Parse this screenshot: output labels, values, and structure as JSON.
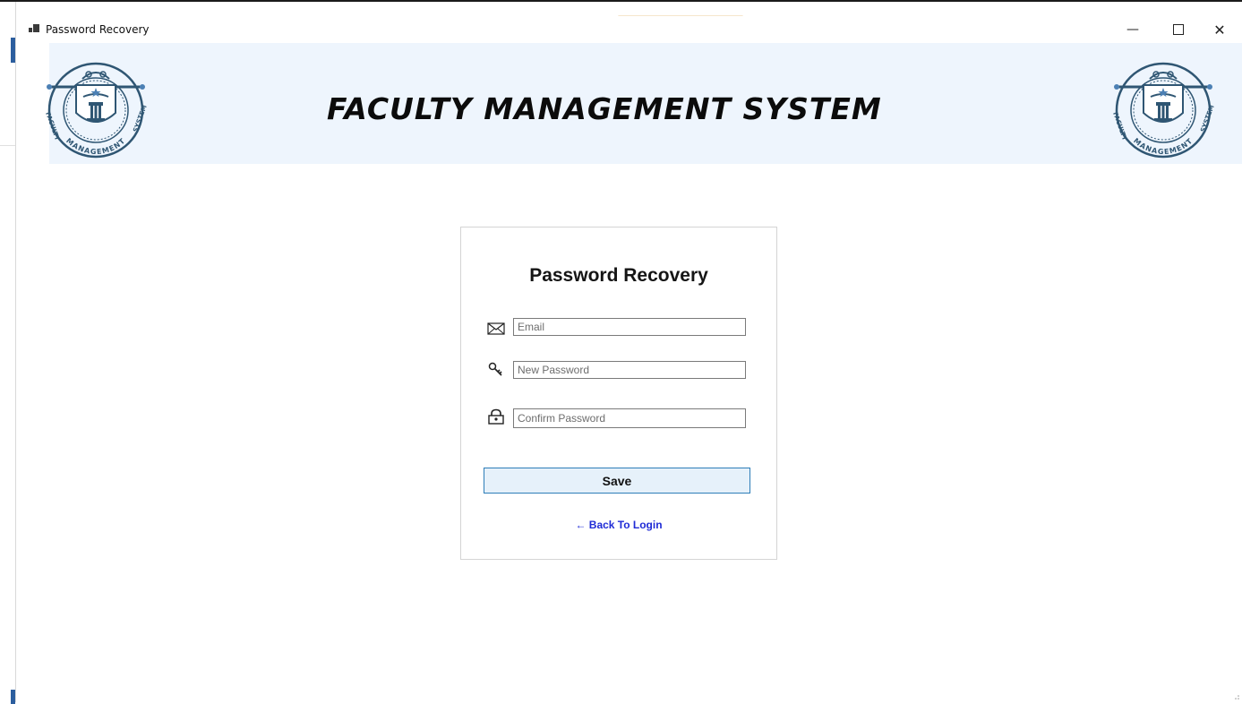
{
  "window": {
    "title": "Password Recovery",
    "controls": {
      "minimize": "—",
      "close": "✕"
    }
  },
  "header": {
    "app_title": "FACULTY MANAGEMENT SYSTEM",
    "logo_text_left": "FACULTY",
    "logo_text_bottom": "MANAGEMENT",
    "logo_text_right": "SYSTEM"
  },
  "form": {
    "title": "Password Recovery",
    "email": {
      "placeholder": "Email",
      "value": "",
      "icon": "envelope-icon"
    },
    "new_password": {
      "placeholder": "New Password",
      "value": "",
      "icon": "key-icon"
    },
    "confirm_password": {
      "placeholder": "Confirm Password",
      "value": "",
      "icon": "lock-icon"
    },
    "save_label": "Save",
    "back_link": "← Back To Login"
  },
  "colors": {
    "header_bg": "#eef5fd",
    "logo_blue": "#2f5673",
    "button_bg": "#e6f1fa",
    "button_border": "#2d7db8",
    "link": "#1f2bd6"
  }
}
